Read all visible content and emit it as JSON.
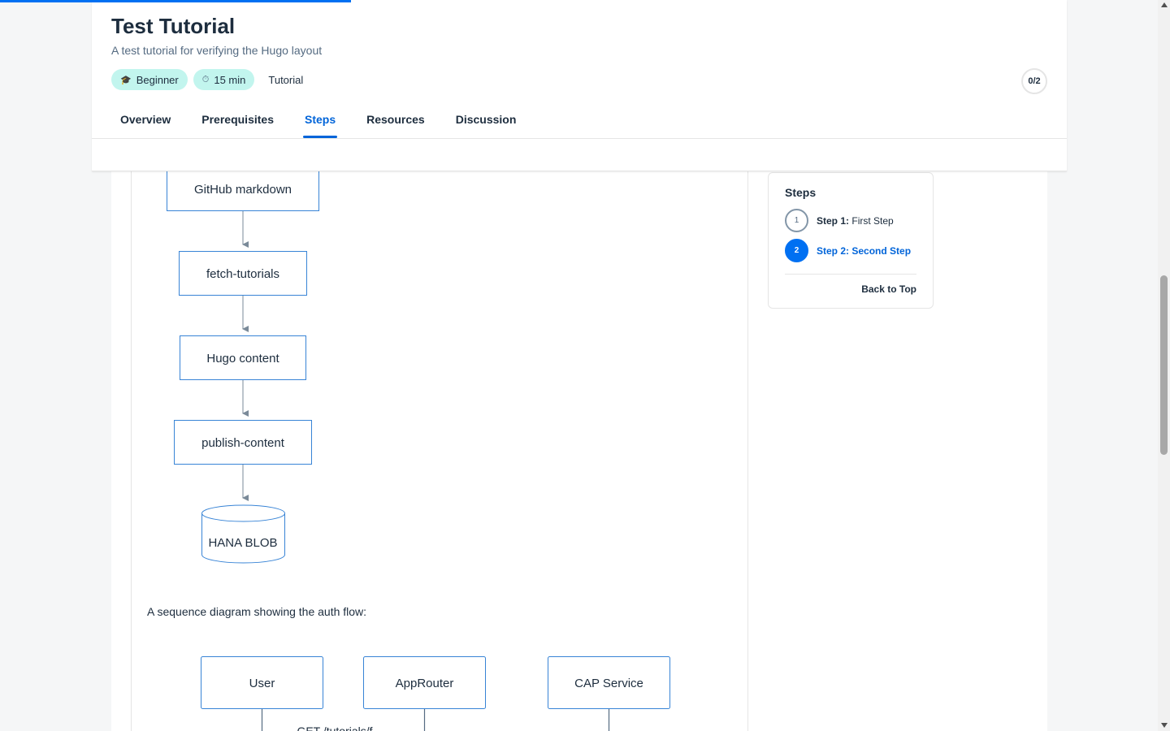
{
  "header": {
    "title": "Test Tutorial",
    "subtitle": "A test tutorial for verifying the Hugo layout",
    "badges": {
      "level": "Beginner",
      "level_icon": "graduation-cap-icon",
      "time": "15 min",
      "time_icon": "stopwatch-icon",
      "type": "Tutorial"
    },
    "progress_counter": "0/2",
    "reading_progress": 0.3
  },
  "tabs": [
    {
      "label": "Overview"
    },
    {
      "label": "Prerequisites"
    },
    {
      "label": "Steps",
      "active": true
    },
    {
      "label": "Resources"
    },
    {
      "label": "Discussion"
    }
  ],
  "flow_diagram": {
    "nodes": [
      "GitHub markdown",
      "fetch-tutorials",
      "Hugo content",
      "publish-content",
      "HANA BLOB"
    ]
  },
  "content": {
    "sequence_intro": "A sequence diagram showing the auth flow:"
  },
  "sequence_diagram": {
    "actors": [
      "User",
      "AppRouter",
      "CAP Service"
    ],
    "first_message": "GET /tutorials/f"
  },
  "sidebar": {
    "title": "Steps",
    "steps": [
      {
        "num": "1",
        "prefix": "Step 1:",
        "name": "First Step"
      },
      {
        "num": "2",
        "prefix": "Step 2:",
        "name": "Second Step",
        "active": true
      }
    ],
    "back_to_top": "Back to Top"
  },
  "colors": {
    "accent": "#0070f2",
    "link": "#0064d9",
    "badge_bg": "#c2f5ee",
    "diagram_stroke": "#3884d6"
  }
}
